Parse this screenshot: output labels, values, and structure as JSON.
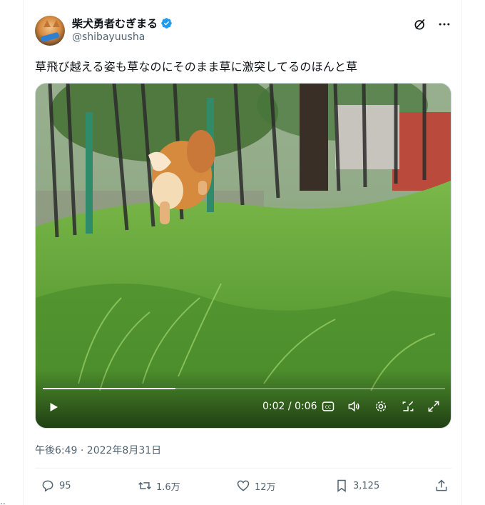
{
  "author": {
    "display_name": "柴犬勇者むぎまる",
    "handle": "@shibayuusha",
    "verified_color": "#1d9bf0"
  },
  "tweet": {
    "text": "草飛び越える姿も草なのにそのまま草に激突してるのほんと草",
    "timestamp": "午後6:49 · 2022年8月31日"
  },
  "video": {
    "time": "0:02 / 0:06",
    "progress": 0.33,
    "icons": [
      "play-icon",
      "captions-icon",
      "volume-icon",
      "settings-icon",
      "pip-icon",
      "fullscreen-icon"
    ]
  },
  "stats": {
    "replies": "95",
    "retweets": "1.6万",
    "likes": "12万",
    "bookmarks": "3,125"
  },
  "edge_mark": ".."
}
